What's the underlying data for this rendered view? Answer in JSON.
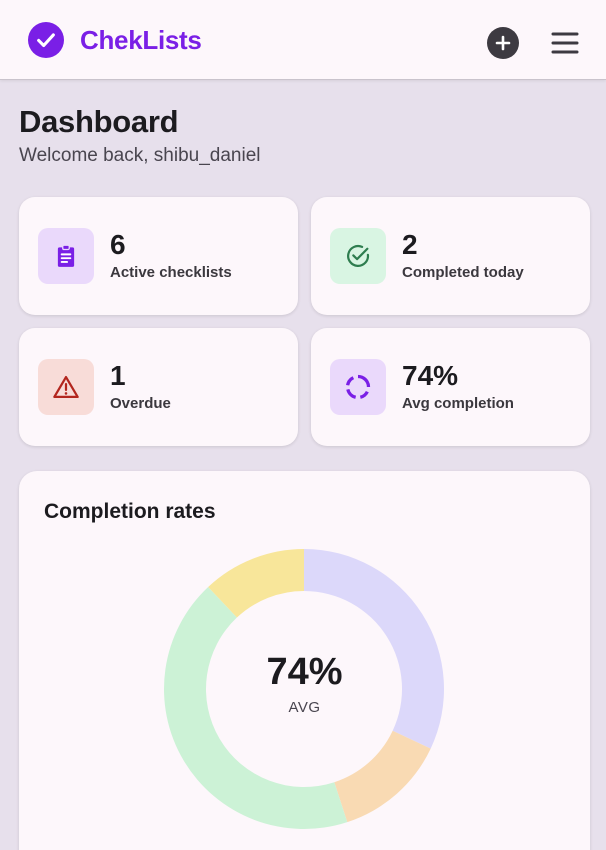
{
  "app": {
    "name": "ChekLists",
    "accent": "#7a1fe6"
  },
  "header": {
    "logo_icon": "check-circle-icon",
    "add_icon": "plus-circle-icon",
    "menu_icon": "hamburger-menu-icon"
  },
  "page": {
    "title": "Dashboard",
    "subtitle": "Welcome back, shibu_daniel"
  },
  "stats": [
    {
      "value": "6",
      "label": "Active checklists",
      "icon": "clipboard-icon",
      "icon_bg": "#ead9fb",
      "icon_color": "#7a1fe6"
    },
    {
      "value": "2",
      "label": "Completed today",
      "icon": "check-circle-outline-icon",
      "icon_bg": "#d9f5e3",
      "icon_color": "#2e7d4f"
    },
    {
      "value": "1",
      "label": "Overdue",
      "icon": "warning-triangle-icon",
      "icon_bg": "#f8dcd8",
      "icon_color": "#b3261e"
    },
    {
      "value": "74%",
      "label": "Avg completion",
      "icon": "progress-ring-icon",
      "icon_bg": "#ead9fb",
      "icon_color": "#7a1fe6"
    }
  ],
  "chart_card": {
    "title": "Completion rates",
    "center_value": "74%",
    "center_label": "AVG"
  },
  "chart_data": {
    "type": "pie",
    "title": "Completion rates",
    "donut": true,
    "values": [
      32,
      13,
      43,
      12
    ],
    "colors": [
      "#dcd8fa",
      "#f9dab3",
      "#ccf2d6",
      "#f8e69a"
    ],
    "center_text": "74%",
    "center_label": "AVG"
  }
}
